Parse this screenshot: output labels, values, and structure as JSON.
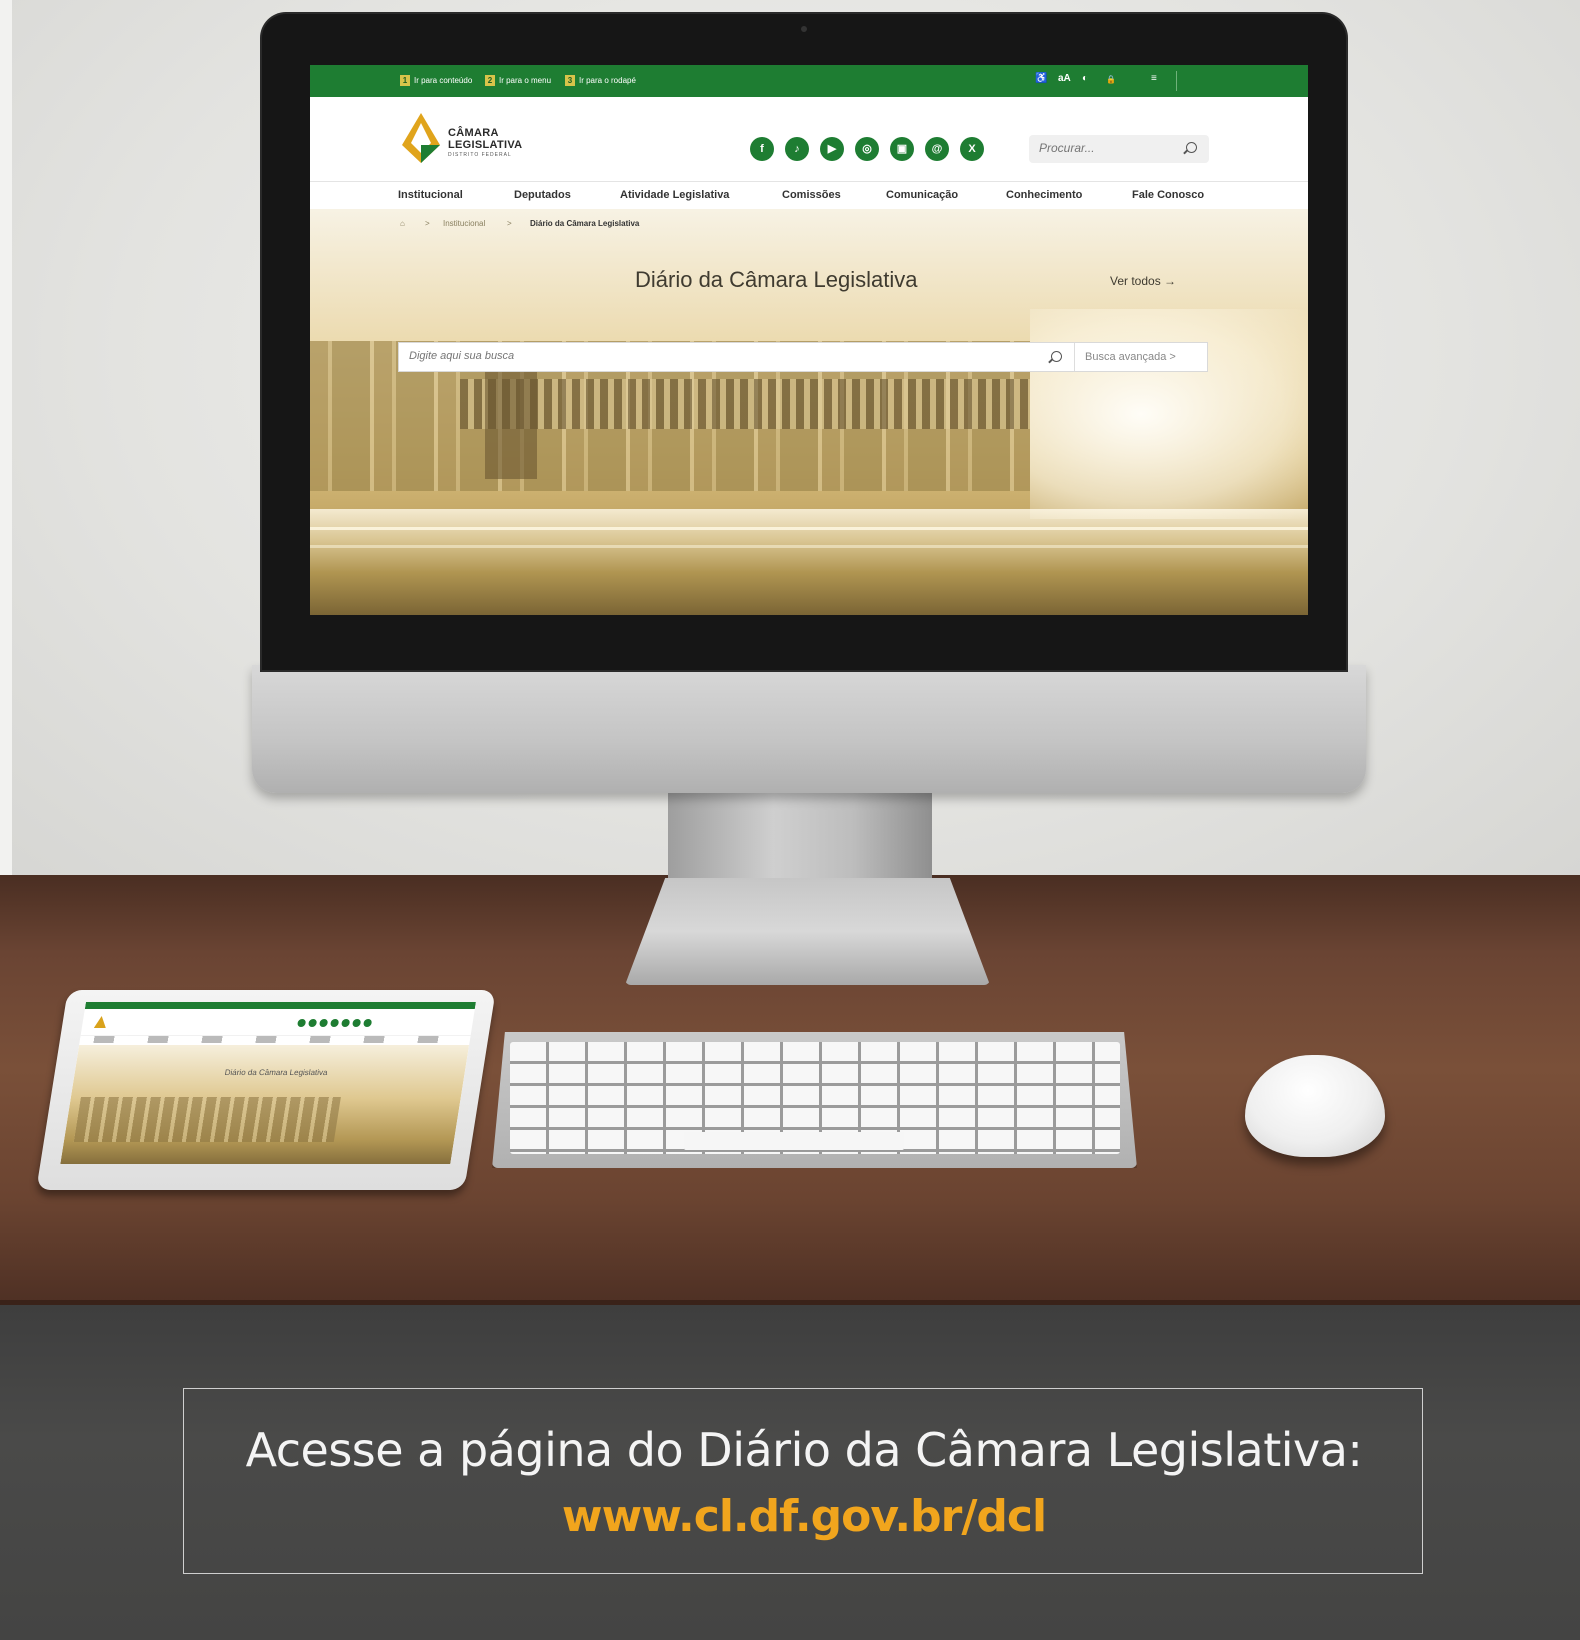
{
  "site": {
    "topbar": {
      "skip_links": [
        {
          "num": "1",
          "label": "Ir para conteúdo"
        },
        {
          "num": "2",
          "label": "Ir para o menu"
        },
        {
          "num": "3",
          "label": "Ir para o rodapé"
        }
      ],
      "accessibility": {
        "libras": "♿",
        "font_size": "aA",
        "contrast": "◐",
        "lock": "🔒",
        "menu": "≡"
      }
    },
    "logo": {
      "line1": "CÂMARA",
      "line2": "LEGISLATIVA",
      "line3": "DISTRITO FEDERAL"
    },
    "social": [
      {
        "icon": "facebook-icon",
        "glyph": "f"
      },
      {
        "icon": "tiktok-icon",
        "glyph": "♪"
      },
      {
        "icon": "youtube-icon",
        "glyph": "▶"
      },
      {
        "icon": "instagram-icon",
        "glyph": "◎"
      },
      {
        "icon": "flickr-icon",
        "glyph": "▣"
      },
      {
        "icon": "threads-icon",
        "glyph": "@"
      },
      {
        "icon": "x-icon",
        "glyph": "X"
      }
    ],
    "search": {
      "placeholder": "Procurar..."
    },
    "nav": [
      "Institucional",
      "Deputados",
      "Atividade Legislativa",
      "Comissões",
      "Comunicação",
      "Conhecimento",
      "Fale Conosco"
    ],
    "breadcrumb": {
      "home": "⌂",
      "sep": ">",
      "level1": "Institucional",
      "current": "Diário da Câmara Legislativa"
    },
    "hero": {
      "title": "Diário da Câmara Legislativa",
      "see_all": "Ver todos →",
      "search_placeholder": "Digite aqui sua busca",
      "advanced_search": "Busca avançada  >"
    }
  },
  "tablet": {
    "title": "Diário da Câmara Legislativa"
  },
  "caption": {
    "text": "Acesse a página do Diário da Câmara Legislativa:",
    "url": "www.cl.df.gov.br/dcl"
  },
  "colors": {
    "brand_green": "#1e7d32",
    "accent_gold": "#f1a51d"
  }
}
